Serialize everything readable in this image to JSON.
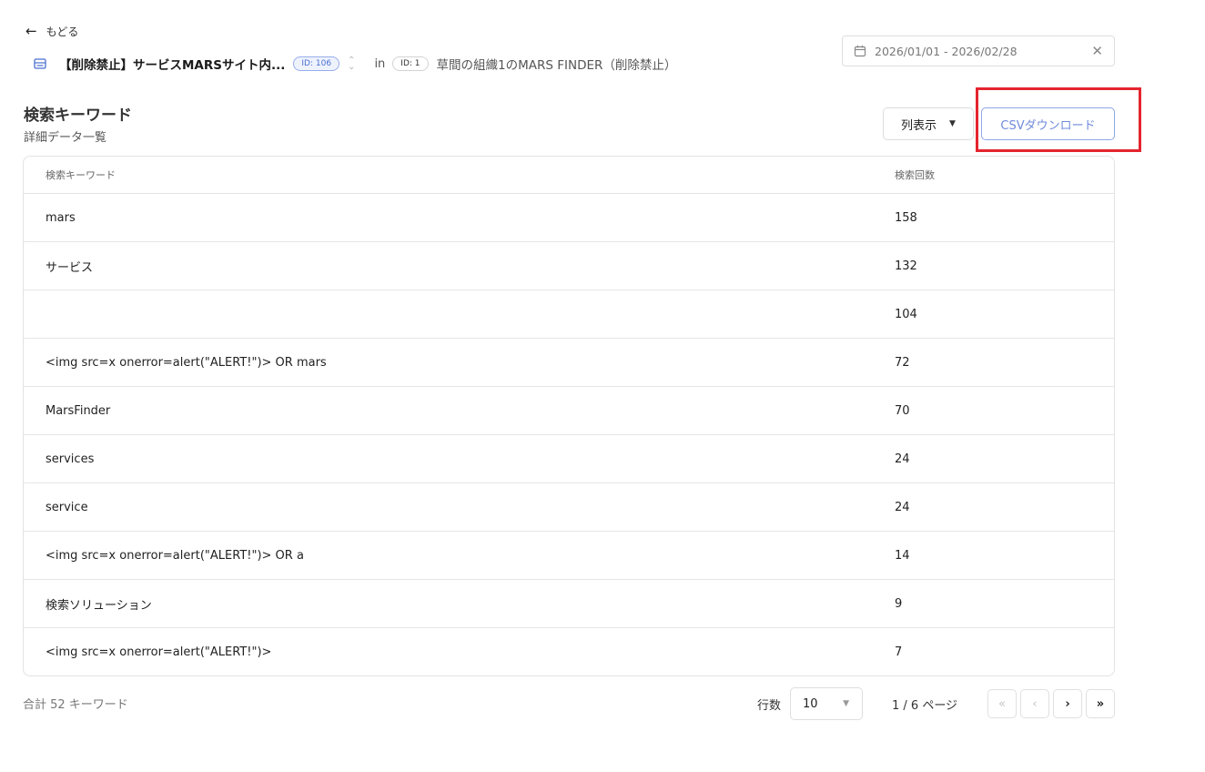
{
  "nav": {
    "back_label": "もどる"
  },
  "breadcrumb": {
    "service_title": "【削除禁止】サービスMARSサイト内...",
    "service_id": "ID: 106",
    "in_label": "in",
    "org_id": "ID: 1",
    "org_name": "草間の組織1のMARS FINDER（削除禁止）"
  },
  "date_range": {
    "value": "2026/01/01 - 2026/02/28"
  },
  "section": {
    "title": "検索キーワード",
    "subtitle": "詳細データ一覧"
  },
  "toolbar": {
    "columns_label": "列表示",
    "csv_label": "CSVダウンロード"
  },
  "table": {
    "headers": {
      "keyword": "検索キーワード",
      "count": "検索回数"
    },
    "rows": [
      {
        "keyword": "mars",
        "count": "158"
      },
      {
        "keyword": "サービス",
        "count": "132"
      },
      {
        "keyword": "",
        "count": "104"
      },
      {
        "keyword": "<img src=x onerror=alert(\"ALERT!\")> OR mars",
        "count": "72"
      },
      {
        "keyword": "MarsFinder",
        "count": "70"
      },
      {
        "keyword": "services",
        "count": "24"
      },
      {
        "keyword": "service",
        "count": "24"
      },
      {
        "keyword": "<img src=x onerror=alert(\"ALERT!\")> OR a",
        "count": "14"
      },
      {
        "keyword": "検索ソリューション",
        "count": "9"
      },
      {
        "keyword": "<img src=x onerror=alert(\"ALERT!\")>",
        "count": "7"
      }
    ]
  },
  "footer": {
    "total": "合計 52 キーワード",
    "rows_label": "行数",
    "rows_value": "10",
    "page_info": "1 / 6 ページ",
    "first_icon": "«",
    "prev_icon": "‹",
    "next_icon": "›",
    "last_icon": "»"
  },
  "colors": {
    "highlight": "#e4252e",
    "accent": "#6f8bdc"
  }
}
